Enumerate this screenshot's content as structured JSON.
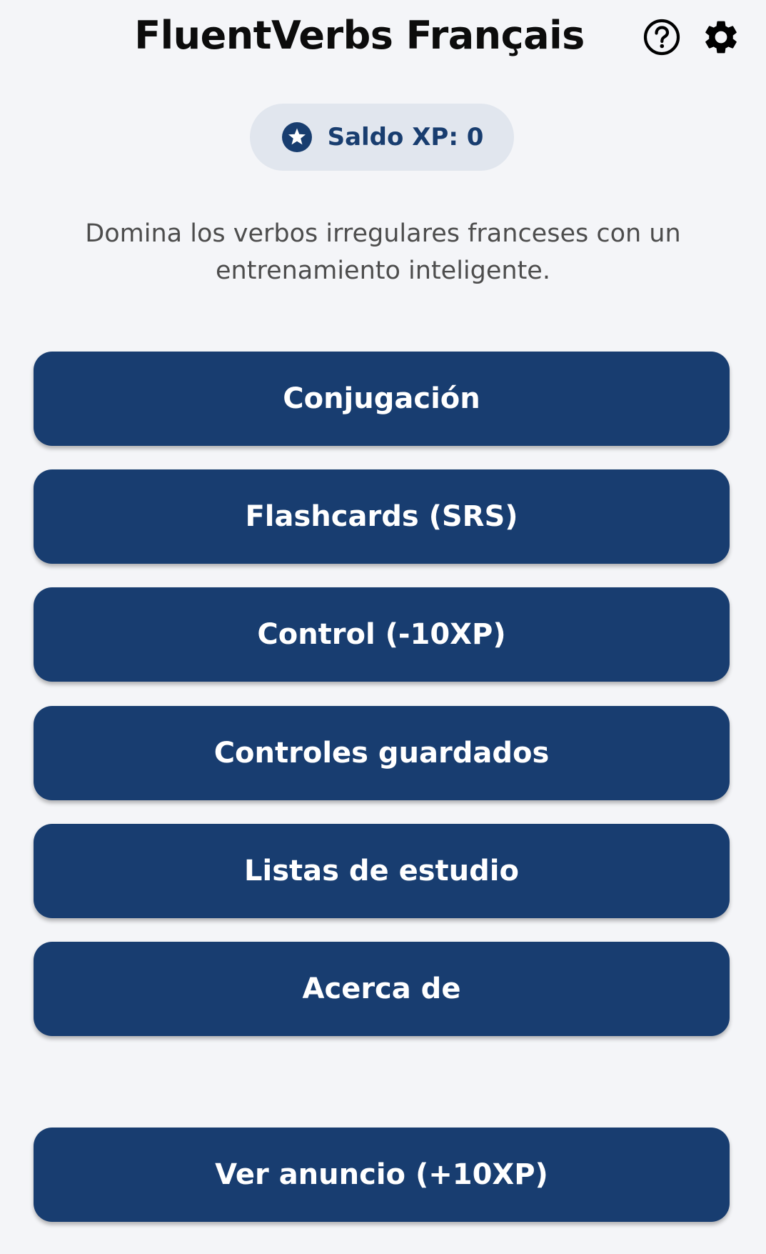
{
  "header": {
    "title": "FluentVerbs Français",
    "help_icon": "help-circle-icon",
    "settings_icon": "gear-icon"
  },
  "xp": {
    "icon": "star-circle-icon",
    "label": "Saldo XP: 0"
  },
  "tagline": "Domina los verbos irregulares franceses con un entrenamiento inteligente.",
  "menu": {
    "conjugation": "Conjugación",
    "flashcards": "Flashcards (SRS)",
    "control": "Control (-10XP)",
    "saved_controls": "Controles guardados",
    "study_lists": "Listas de estudio",
    "about": "Acerca de",
    "watch_ad": "Ver anuncio (+10XP)"
  },
  "colors": {
    "background": "#f4f5f8",
    "primary": "#183d70",
    "pill_background": "#e1e6ee",
    "button_text": "#ffffff"
  }
}
